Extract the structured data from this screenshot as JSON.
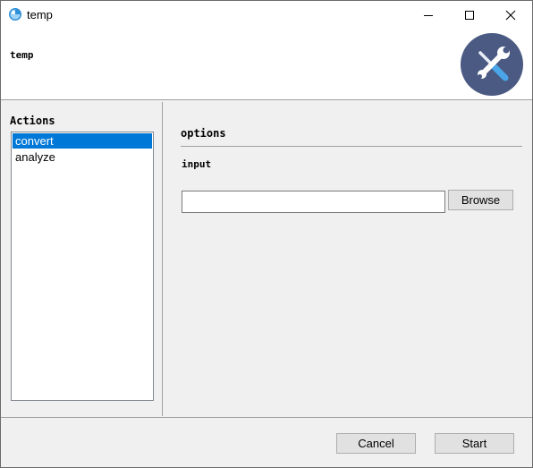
{
  "window": {
    "title": "temp",
    "controls": {
      "minimize": "minimize-icon",
      "maximize": "maximize-icon",
      "close": "close-icon"
    }
  },
  "header": {
    "title": "temp",
    "logo_icon": "tools-wrench-screwdriver-icon",
    "logo_bg": "#4a5a82",
    "logo_fg": "#ffffff",
    "logo_accent": "#4aa6e8"
  },
  "sidebar": {
    "label": "Actions",
    "items": [
      {
        "label": "convert",
        "selected": true
      },
      {
        "label": "analyze",
        "selected": false
      }
    ],
    "selection_color": "#0078d7"
  },
  "main": {
    "section_title": "options",
    "input": {
      "label": "input",
      "value": "",
      "placeholder": ""
    },
    "browse_label": "Browse"
  },
  "footer": {
    "cancel_label": "Cancel",
    "start_label": "Start"
  }
}
